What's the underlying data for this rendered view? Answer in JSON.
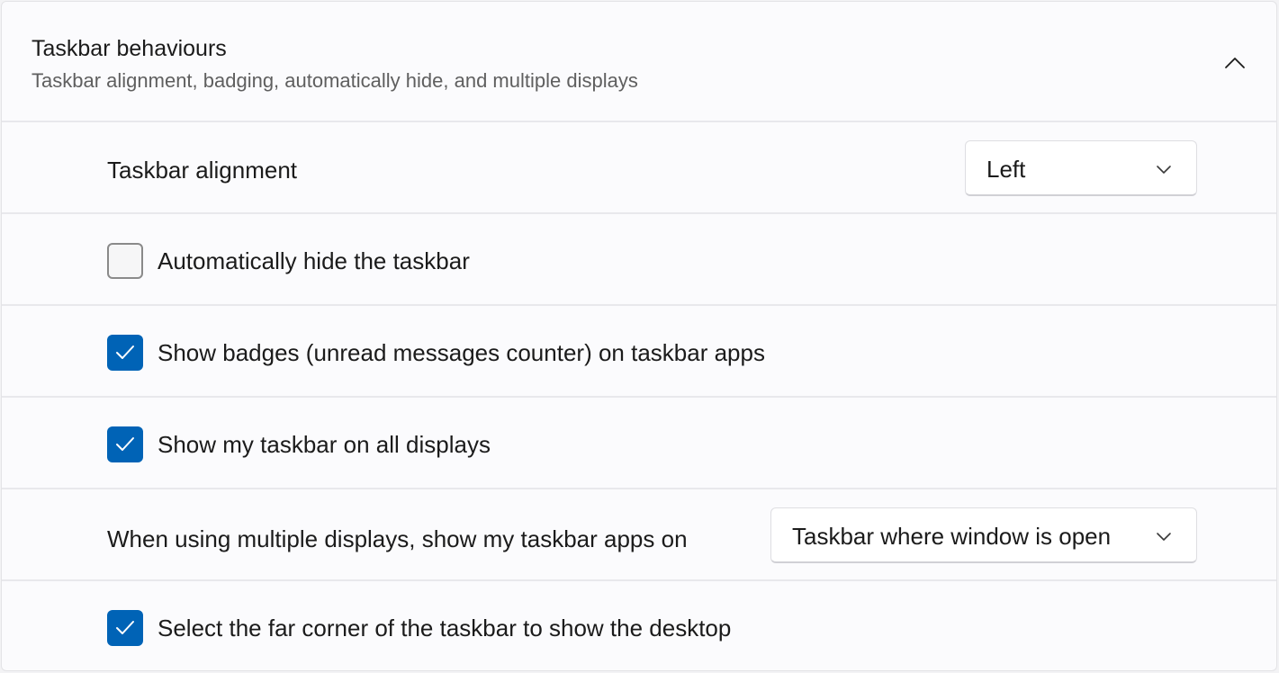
{
  "header": {
    "title": "Taskbar behaviours",
    "subtitle": "Taskbar alignment, badging, automatically hide, and multiple displays",
    "expand_icon": "chevron-up-icon"
  },
  "settings": {
    "alignment": {
      "label": "Taskbar alignment",
      "value": "Left"
    },
    "auto_hide": {
      "label": "Automatically hide the taskbar",
      "checked": false
    },
    "badges": {
      "label": "Show badges (unread messages counter) on taskbar apps",
      "checked": true
    },
    "all_displays": {
      "label": "Show my taskbar on all displays",
      "checked": true
    },
    "multi_display_apps": {
      "label": "When using multiple displays, show my taskbar apps on",
      "value": "Taskbar where window is open"
    },
    "far_corner": {
      "label": "Select the far corner of the taskbar to show the desktop",
      "checked": true
    }
  },
  "colors": {
    "accent": "#0063b6",
    "panel_background": "#fbfbfd",
    "divider": "#e8e8ec"
  }
}
